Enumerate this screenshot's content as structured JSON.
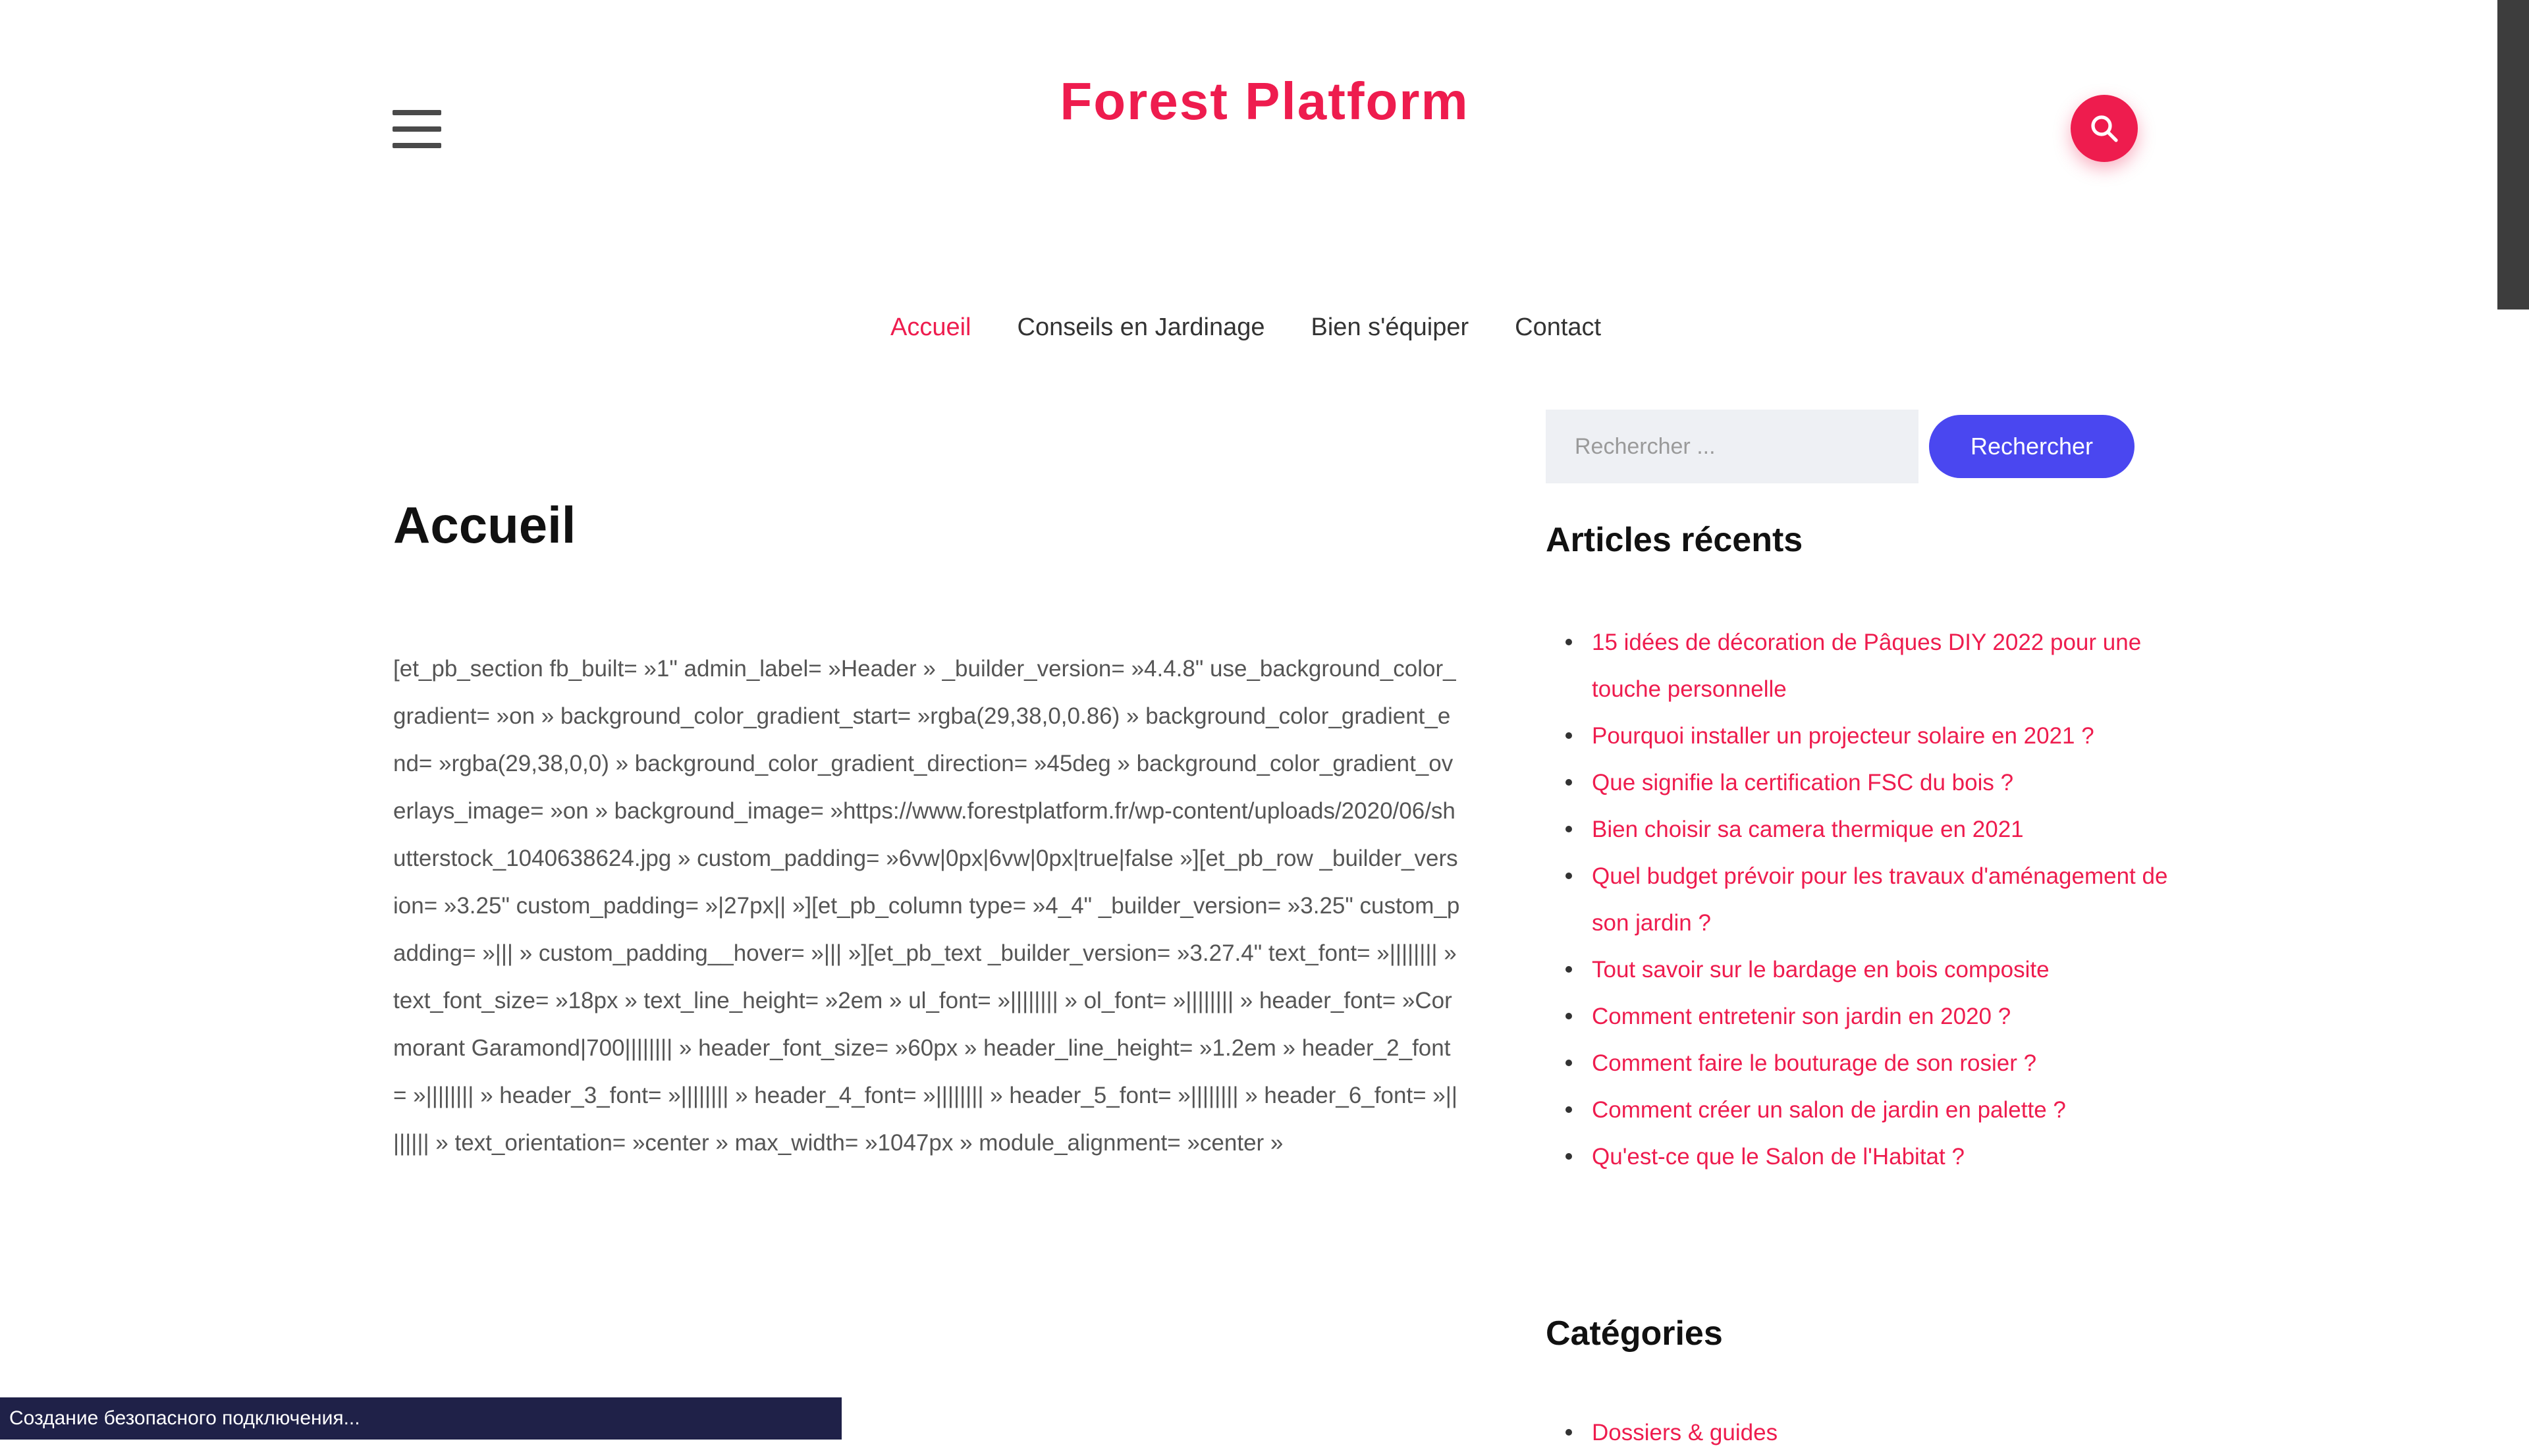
{
  "header": {
    "site_title": "Forest Platform",
    "menu_icon": "hamburger-menu-icon",
    "search_icon": "search-icon",
    "accent_color": "#ee1c4e"
  },
  "nav": {
    "items": [
      {
        "label": "Accueil",
        "active": true
      },
      {
        "label": "Conseils en Jardinage",
        "active": false
      },
      {
        "label": "Bien s'équiper",
        "active": false
      },
      {
        "label": "Contact",
        "active": false
      }
    ]
  },
  "main": {
    "title": "Accueil",
    "content": "[et_pb_section fb_built= »1\" admin_label= »Header » _builder_version= »4.4.8\" use_background_color_gradient= »on » background_color_gradient_start= »rgba(29,38,0,0.86) » background_color_gradient_end= »rgba(29,38,0,0) » background_color_gradient_direction= »45deg » background_color_gradient_overlays_image= »on » background_image= »https://www.forestplatform.fr/wp-content/uploads/2020/06/shutterstock_1040638624.jpg » custom_padding= »6vw|0px|6vw|0px|true|false »][et_pb_row _builder_version= »3.25\" custom_padding= »|27px|| »][et_pb_column type= »4_4\" _builder_version= »3.25\" custom_padding= »||| » custom_padding__hover= »||| »][et_pb_text _builder_version= »3.27.4\" text_font= »|||||||| » text_font_size= »18px » text_line_height= »2em » ul_font= »|||||||| » ol_font= »|||||||| » header_font= »Cormorant Garamond|700|||||||| » header_font_size= »60px » header_line_height= »1.2em » header_2_font= »|||||||| » header_3_font= »|||||||| » header_4_font= »|||||||| » header_5_font= »|||||||| » header_6_font= »|||||||| » text_orientation= »center » max_width= »1047px » module_alignment= »center »"
  },
  "sidebar": {
    "search": {
      "placeholder": "Rechercher ...",
      "button_label": "Rechercher",
      "button_color": "#4a47f0"
    },
    "recent_title": "Articles récents",
    "recent_posts": [
      {
        "title": "15 idées de décoration de Pâques DIY 2022 pour une touche personnelle"
      },
      {
        "title": "Pourquoi installer un projecteur solaire en 2021 ?"
      },
      {
        "title": "Que signifie la certification FSC du bois ?"
      },
      {
        "title": "Bien choisir sa camera thermique en 2021"
      },
      {
        "title": "Quel budget prévoir pour les travaux d'aménagement de son jardin ?"
      },
      {
        "title": "Tout savoir sur le bardage en bois composite"
      },
      {
        "title": "Comment entretenir son jardin en 2020 ?"
      },
      {
        "title": "Comment faire le bouturage de son rosier ?"
      },
      {
        "title": "Comment créer un salon de jardin en palette ?"
      },
      {
        "title": "Qu'est-ce que le Salon de l'Habitat ?"
      }
    ],
    "categories_title": "Catégories",
    "categories": [
      {
        "label": "Dossiers & guides"
      }
    ]
  },
  "status_bar": {
    "text": "Создание безопасного подключения..."
  }
}
